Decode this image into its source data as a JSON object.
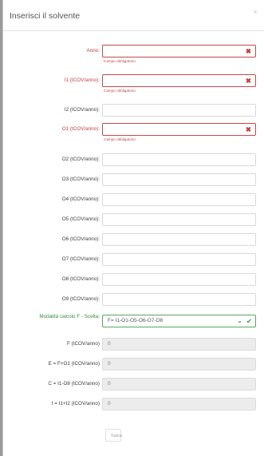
{
  "modal": {
    "title": "Inserisci il solvente",
    "close_icon": "×",
    "save_label": "Salva"
  },
  "required_message": "Campo obbligatorio",
  "fields": [
    {
      "label": "Anno:",
      "value": "",
      "state": "error"
    },
    {
      "label": "I1 (tCOV/anno):",
      "value": "",
      "state": "error"
    },
    {
      "label": "I2 (tCOV/anno):",
      "value": "",
      "state": "normal"
    },
    {
      "label": "O1 (tCOV/anno):",
      "value": "",
      "state": "error"
    },
    {
      "label": "O2 (tCOV/anno):",
      "value": "",
      "state": "normal"
    },
    {
      "label": "O3 (tCOV/anno):",
      "value": "",
      "state": "normal"
    },
    {
      "label": "O4 (tCOV/anno):",
      "value": "",
      "state": "normal"
    },
    {
      "label": "O5 (tCOV/anno):",
      "value": "",
      "state": "normal"
    },
    {
      "label": "O6 (tCOV/anno):",
      "value": "",
      "state": "normal"
    },
    {
      "label": "O7 (tCOV/anno):",
      "value": "",
      "state": "normal"
    },
    {
      "label": "O8 (tCOV/anno):",
      "value": "",
      "state": "normal"
    },
    {
      "label": "O9 (tCOV/anno):",
      "value": "",
      "state": "normal"
    }
  ],
  "select": {
    "label": "Modalità calcolo F - Scelta:",
    "value": "F= I1-O1-O5-O6-O7-O8",
    "state": "valid"
  },
  "computed": [
    {
      "label": "F (tCOV/anno)",
      "value": "0"
    },
    {
      "label": "E = F+O1 (tCOV/anno)",
      "value": "0"
    },
    {
      "label": "C = I1-O8 (tCOV/anno)",
      "value": "0"
    },
    {
      "label": "I = I1+I2 (tCOV/anno)",
      "value": "0"
    }
  ],
  "icons": {
    "error": "times-icon",
    "dropdown": "chevron-down-icon",
    "valid": "check-icon"
  },
  "colors": {
    "error": "#c24a4a",
    "valid": "#57a75a",
    "readonly_bg": "#ececec"
  }
}
